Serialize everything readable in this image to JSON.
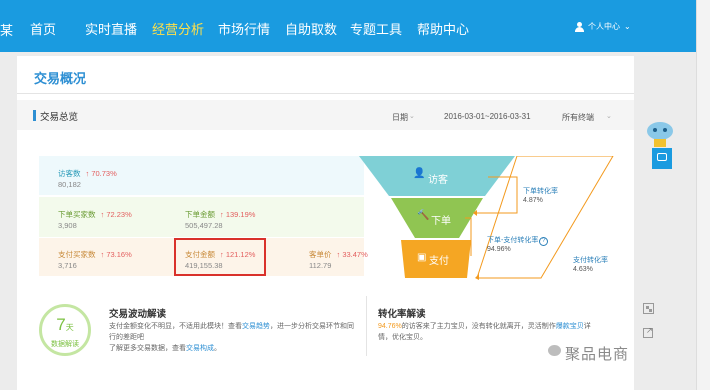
{
  "nav": {
    "edge_text": "某",
    "items": [
      {
        "label": "首页",
        "active": false
      },
      {
        "label": "实时直播",
        "active": false
      },
      {
        "label": "经营分析",
        "active": true
      },
      {
        "label": "市场行情",
        "active": false
      },
      {
        "label": "自助取数",
        "active": false
      },
      {
        "label": "专题工具",
        "active": false
      },
      {
        "label": "帮助中心",
        "active": false
      }
    ],
    "user_label": "个人中心",
    "user_caret": "⌄"
  },
  "page": {
    "title": "交易概况"
  },
  "section": {
    "title": "交易总览",
    "date_label": "日期",
    "date_range": "2016-03-01~2016-03-31",
    "terminal": "所有终端",
    "caret": "⌄"
  },
  "stats": {
    "visitors": {
      "label": "访客数",
      "change": "↑ 70.73%",
      "value": "80,182"
    },
    "order_buyers": {
      "label": "下单买家数",
      "change": "↑ 72.23%",
      "value": "3,908"
    },
    "order_amount": {
      "label": "下单金额",
      "change": "↑ 139.19%",
      "value": "505,497.28"
    },
    "pay_buyers": {
      "label": "支付买家数",
      "change": "↑ 73.16%",
      "value": "3,716"
    },
    "pay_amount": {
      "label": "支付金额",
      "change": "↑ 121.12%",
      "value": "419,155.38"
    },
    "unit_price": {
      "label": "客单价",
      "change": "↑ 33.47%",
      "value": "112.79"
    }
  },
  "funnel": {
    "visit": "访客",
    "order": "下单",
    "pay": "支付",
    "order_rate_label": "下单转化率",
    "order_rate_value": "4.87%",
    "order_pay_rate_label": "下单-支付转化率",
    "order_pay_rate_value": "94.96%",
    "pay_rate_label": "支付转化率",
    "pay_rate_value": "4.63%"
  },
  "fluctuation": {
    "badge_num": "7",
    "badge_unit": "天",
    "badge_text": "数据解读",
    "title": "交易波动解读",
    "line1_a": "支付金额变化不明显，不适用此模块！查看",
    "line1_link": "交易趋势",
    "line1_b": "，进一步分析交易环节和同",
    "line2": "行的差距吧",
    "line3_a": "了解更多交易数据，查看",
    "line3_link": "交易构成",
    "line3_b": "。"
  },
  "conversion": {
    "title": "转化率解读",
    "line1_pct": "94.76%",
    "line1_a": "的访客来了主力宝贝，没有转化就离开，灵活制作",
    "line1_link": "爆款宝贝",
    "line1_b": "详",
    "line2": "情，优化宝贝。"
  },
  "watermark": "聚品电商",
  "colors": {
    "nav_bg": "#1a9be0",
    "accent": "#2d8fd3",
    "funnel_visit": "#7fd0d6",
    "funnel_order": "#90c552",
    "funnel_pay": "#f5a623",
    "highlight": "#d9312b"
  }
}
